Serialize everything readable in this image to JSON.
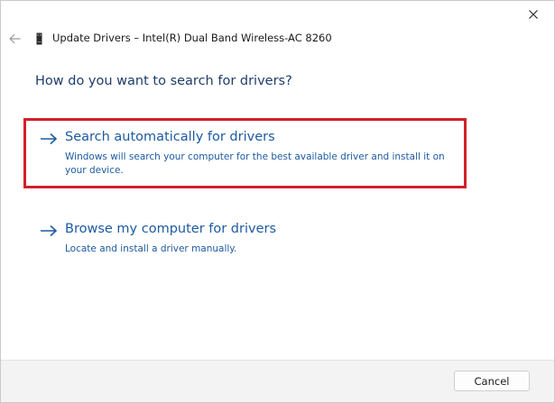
{
  "window": {
    "title": "Update Drivers – Intel(R) Dual Band Wireless-AC 8260"
  },
  "main": {
    "question": "How do you want to search for drivers?",
    "options": [
      {
        "title": "Search automatically for drivers",
        "description": "Windows will search your computer for the best available driver and install it on your device.",
        "icon": "arrow-right-icon",
        "highlighted": true
      },
      {
        "title": "Browse my computer for drivers",
        "description": "Locate and install a driver manually.",
        "icon": "arrow-right-icon",
        "highlighted": false
      }
    ]
  },
  "footer": {
    "cancel_label": "Cancel"
  },
  "colors": {
    "link": "#1d5aa0",
    "heading": "#1e3d6b",
    "highlight": "#d3202a",
    "footer_bg": "#f3f3f3"
  },
  "icons": {
    "close": "close-icon",
    "back": "back-arrow-icon",
    "device": "device-icon"
  }
}
